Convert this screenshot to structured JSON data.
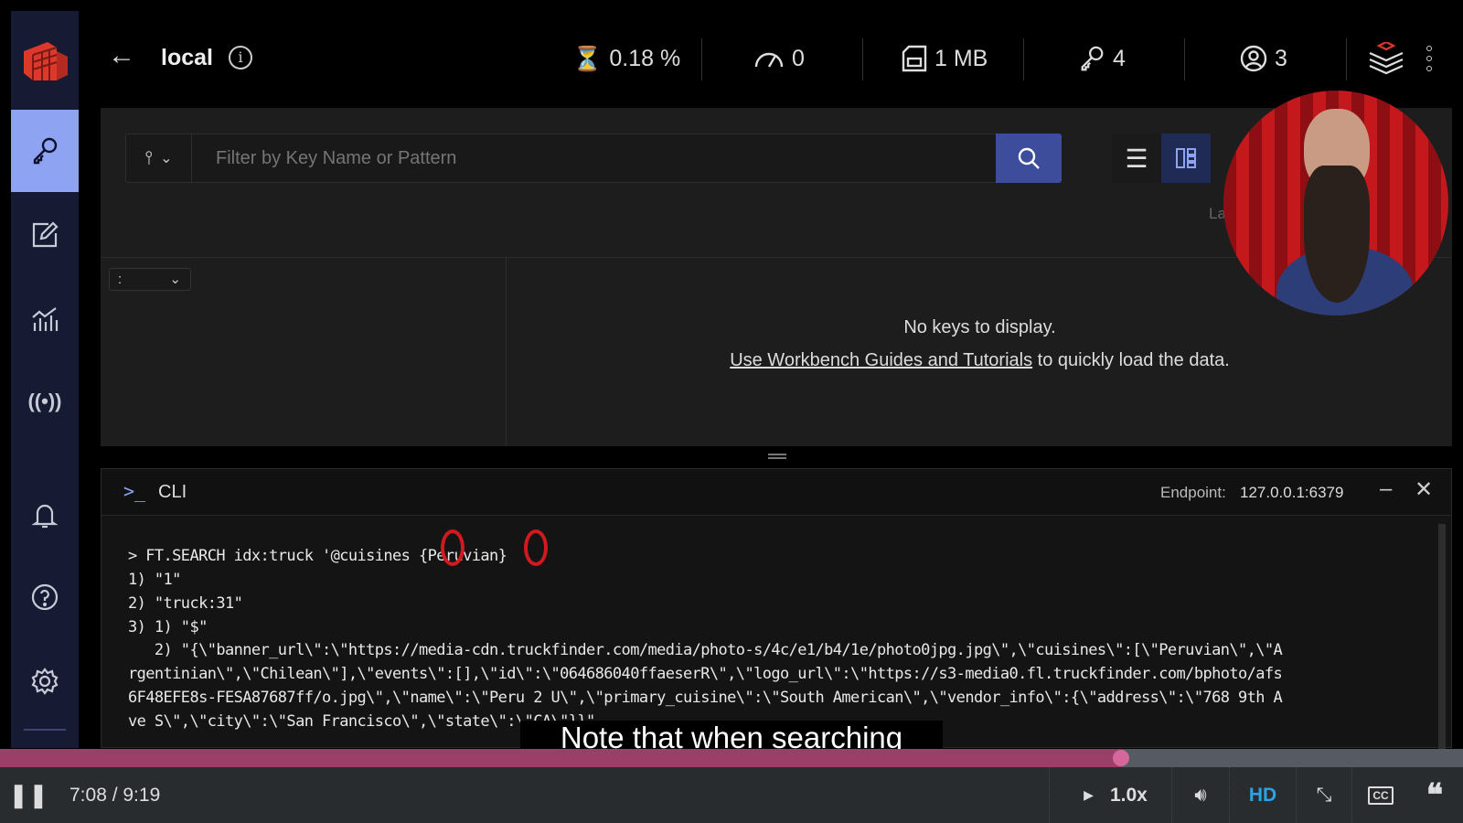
{
  "header": {
    "db_name": "local",
    "stats": [
      {
        "icon": "cpu-icon",
        "value": "0.18 %"
      },
      {
        "icon": "speedometer-icon",
        "value": "0"
      },
      {
        "icon": "memory-icon",
        "value": "1 MB"
      },
      {
        "icon": "key-icon",
        "value": "4"
      },
      {
        "icon": "user-icon",
        "value": "3"
      }
    ]
  },
  "sidebar": {
    "items": [
      "browser",
      "workbench",
      "analysis",
      "pub-sub",
      "notifications",
      "help",
      "settings"
    ],
    "active": "browser"
  },
  "browser": {
    "search_placeholder": "Filter by Key Name or Pattern",
    "delimiter": ":",
    "partial_label": "La",
    "empty_title": "No keys to display.",
    "empty_link": "Use Workbench Guides and Tutorials",
    "empty_suffix": " to quickly load the data."
  },
  "cli": {
    "title": "CLI",
    "endpoint_label": "Endpoint:",
    "endpoint": "127.0.0.1:6379",
    "lines": [
      "> FT.SEARCH idx:truck '@cuisines {Peruvian}",
      "1) \"1\"",
      "2) \"truck:31\"",
      "3) 1) \"$\"",
      "   2) \"{\\\"banner_url\\\":\\\"https://media-cdn.truckfinder.com/media/photo-s/4c/e1/b4/1e/photo0jpg.jpg\\\",\\\"cuisines\\\":[\\\"Peruvian\\\",\\\"A",
      "rgentinian\\\",\\\"Chilean\\\"],\\\"events\\\":[],\\\"id\\\":\\\"064686040ffaeserR\\\",\\\"logo_url\\\":\\\"https://s3-media0.fl.truckfinder.com/bphoto/afs",
      "6F48EFE8s-FESA87687ff/o.jpg\\\",\\\"name\\\":\\\"Peru 2 U\\\",\\\"primary_cuisine\\\":\\\"South American\\\",\\\"vendor_info\\\":{\\\"address\\\":\\\"768 9th A",
      "ve S\\\",\\\"city\\\":\\\"San Francisco\\\",\\\"state\\\":\\\"CA\\\"}}\""
    ]
  },
  "video": {
    "caption": "Note that when searching",
    "time": "7:08 / 9:19",
    "progress_percent": 76.6,
    "speed": "1.0x",
    "quality": "HD",
    "accent": "#c8487a"
  }
}
